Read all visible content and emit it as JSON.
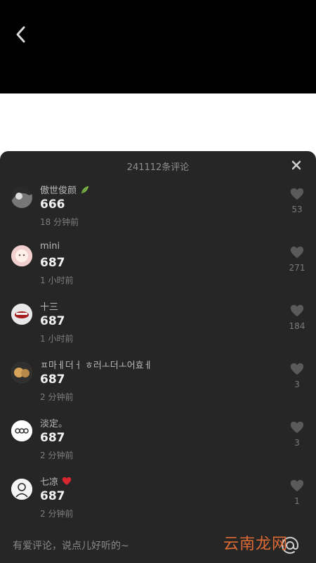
{
  "header": {
    "back_icon": "chevron-left-icon"
  },
  "sheet": {
    "title": "241112条评论",
    "close_icon": "close-icon"
  },
  "comments": [
    {
      "name": "傲世俊颜",
      "text": "666",
      "time": "18 分钟前",
      "likes": "53",
      "avatar_color": "#2a2a2a"
    },
    {
      "name": "mini",
      "text": "687",
      "time": "1 小时前",
      "likes": "271",
      "avatar_color": "#f2d0cf"
    },
    {
      "name": "十三",
      "text": "687",
      "time": "1 小时前",
      "likes": "184",
      "avatar_color": "#d9d9d9"
    },
    {
      "name": "ㅍ마ㅔ더ㅓ ㅎ러ㅗ더ㅗ어효ㅔ",
      "text": "687",
      "time": "2 分钟前",
      "likes": "3",
      "avatar_color": "#b88a49"
    },
    {
      "name": "淡定。",
      "text": "687",
      "time": "2 分钟前",
      "likes": "3",
      "avatar_color": "#ffffff"
    },
    {
      "name": "七凉",
      "text": "687",
      "time": "2 分钟前",
      "likes": "1",
      "avatar_color": "#f4f4f4"
    }
  ],
  "input": {
    "placeholder": "有爱评论，说点儿好听的~",
    "emoji_icon": "at-icon"
  },
  "watermark": {
    "text": "云南龙网"
  }
}
